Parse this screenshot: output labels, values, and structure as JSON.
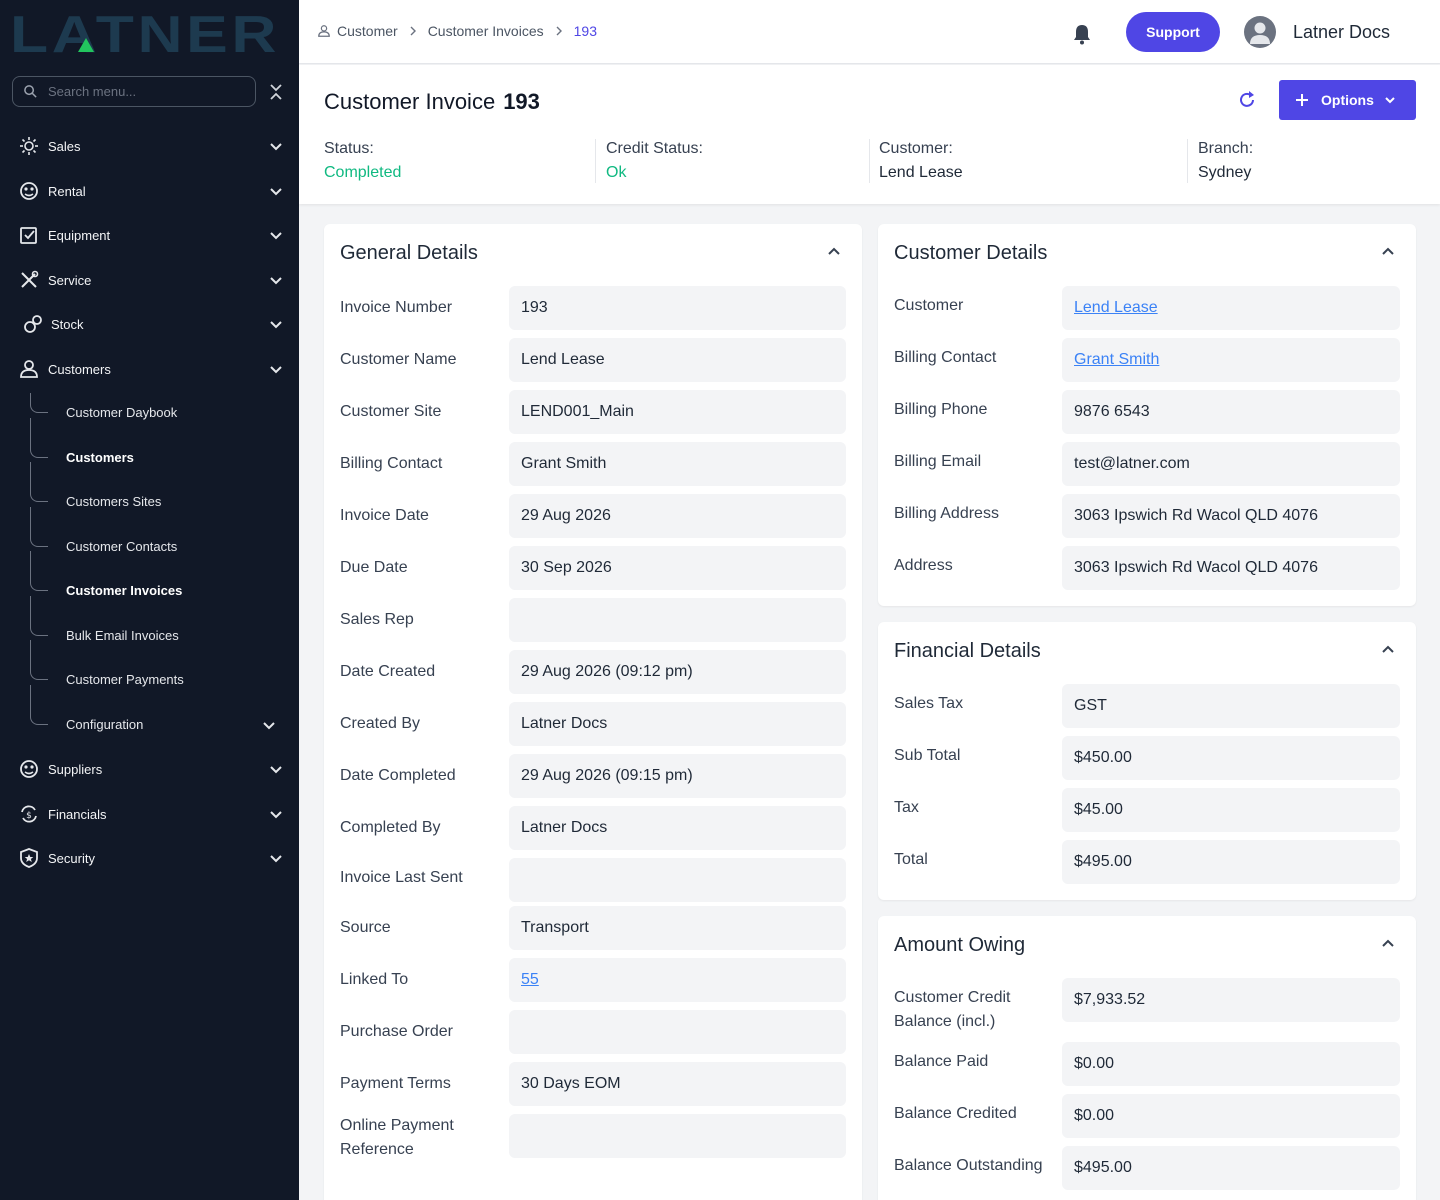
{
  "brand": {
    "logo_text": "LATNER"
  },
  "sidebar": {
    "search_placeholder": "Search menu...",
    "items": [
      {
        "label": "Sales",
        "icon": "sales-icon"
      },
      {
        "label": "Rental",
        "icon": "rental-icon"
      },
      {
        "label": "Equipment",
        "icon": "equipment-icon"
      },
      {
        "label": "Service",
        "icon": "service-icon"
      },
      {
        "label": "Stock",
        "icon": "stock-icon"
      },
      {
        "label": "Customers",
        "icon": "user-icon"
      },
      {
        "label": "Suppliers",
        "icon": "suppliers-icon"
      },
      {
        "label": "Financials",
        "icon": "financials-icon"
      },
      {
        "label": "Security",
        "icon": "shield-icon"
      }
    ],
    "sub_items": [
      {
        "label": "Customer Daybook"
      },
      {
        "label": "Customers"
      },
      {
        "label": "Customers Sites"
      },
      {
        "label": "Customer Contacts"
      },
      {
        "label": "Customer Invoices"
      },
      {
        "label": "Bulk Email Invoices"
      },
      {
        "label": "Customer Payments"
      },
      {
        "label": "Configuration"
      }
    ]
  },
  "topbar": {
    "breadcrumbs": [
      "Customer",
      "Customer Invoices",
      "193"
    ],
    "support_label": "Support",
    "user_name": "Latner Docs"
  },
  "header": {
    "title": "Customer Invoice",
    "number": "193",
    "options_label": "Options",
    "status_label": "Status:",
    "status_value": "Completed",
    "credit_label": "Credit Status:",
    "credit_value": "Ok",
    "customer_label": "Customer:",
    "customer_value": "Lend Lease",
    "branch_label": "Branch:",
    "branch_value": "Sydney"
  },
  "general": {
    "title": "General Details",
    "fields": [
      {
        "label": "Invoice Number",
        "value": "193"
      },
      {
        "label": "Customer Name",
        "value": "Lend Lease"
      },
      {
        "label": "Customer Site",
        "value": "LEND001_Main"
      },
      {
        "label": "Billing Contact",
        "value": "Grant Smith"
      },
      {
        "label": "Invoice Date",
        "value": "29 Aug 2026"
      },
      {
        "label": "Due Date",
        "value": "30 Sep 2026"
      },
      {
        "label": "Sales Rep",
        "value": ""
      },
      {
        "label": "Date Created",
        "value": "29 Aug 2026 (09:12 pm)"
      },
      {
        "label": "Created By",
        "value": "Latner Docs"
      },
      {
        "label": "Date Completed",
        "value": "29 Aug 2026 (09:15 pm)"
      },
      {
        "label": "Completed By",
        "value": "Latner Docs"
      },
      {
        "label": "Invoice Last Sent",
        "value": ""
      },
      {
        "label": "Source",
        "value": "Transport"
      },
      {
        "label": "Linked To",
        "value": "55"
      },
      {
        "label": "Purchase Order",
        "value": ""
      },
      {
        "label": "Payment Terms",
        "value": "30 Days EOM"
      },
      {
        "label": "Online Payment Reference",
        "value": ""
      }
    ]
  },
  "customer": {
    "title": "Customer Details",
    "fields": [
      {
        "label": "Customer",
        "value": "Lend Lease"
      },
      {
        "label": "Billing Contact",
        "value": "Grant Smith"
      },
      {
        "label": "Billing Phone",
        "value": "9876 6543"
      },
      {
        "label": "Billing Email",
        "value": "test@latner.com"
      },
      {
        "label": "Billing Address",
        "value": "3063 Ipswich Rd Wacol QLD 4076"
      },
      {
        "label": "Address",
        "value": "3063 Ipswich Rd Wacol QLD 4076"
      }
    ]
  },
  "financial": {
    "title": "Financial Details",
    "fields": [
      {
        "label": "Sales Tax",
        "value": "GST"
      },
      {
        "label": "Sub Total",
        "value": "$450.00"
      },
      {
        "label": "Tax",
        "value": "$45.00"
      },
      {
        "label": "Total",
        "value": "$495.00"
      }
    ]
  },
  "owing": {
    "title": "Amount Owing",
    "fields": [
      {
        "label": "Customer Credit Balance (incl.)",
        "value": "$7,933.52"
      },
      {
        "label": "Balance Paid",
        "value": "$0.00"
      },
      {
        "label": "Balance Credited",
        "value": "$0.00"
      },
      {
        "label": "Balance Outstanding",
        "value": "$495.00"
      }
    ]
  },
  "colors": {
    "accent": "#4f46e5",
    "success": "#10b981",
    "sidebar_bg": "#111827",
    "link": "#3b82f6"
  }
}
